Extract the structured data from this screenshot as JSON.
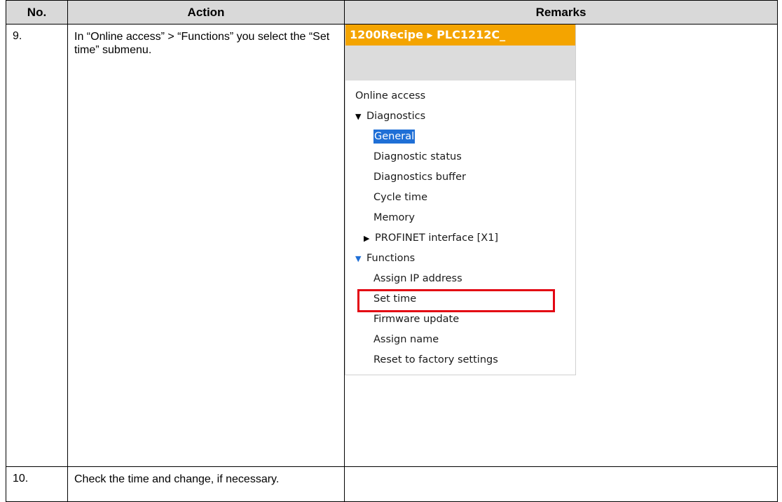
{
  "table": {
    "headers": {
      "no": "No.",
      "action": "Action",
      "remarks": "Remarks"
    },
    "rows": [
      {
        "no": "9.",
        "action": "In “Online access” > “Functions” you select the “Set time” submenu."
      },
      {
        "no": "10.",
        "action": "Check the time and change, if necessary."
      }
    ]
  },
  "panel": {
    "breadcrumb": "1200Recipe  ▸  PLC1212C_",
    "tree": {
      "online_access": "Online access",
      "diagnostics": "Diagnostics",
      "general": "General",
      "diagnostic_status": "Diagnostic status",
      "diagnostics_buffer": "Diagnostics buffer",
      "cycle_time": "Cycle time",
      "memory": "Memory",
      "profinet": "PROFINET interface [X1]",
      "functions": "Functions",
      "assign_ip": "Assign IP address",
      "set_time": "Set time",
      "firmware_update": "Firmware update",
      "assign_name": "Assign name",
      "reset_factory": "Reset to factory settings"
    },
    "colors": {
      "title_bar": "#f4a400",
      "selection": "#1f6fd6",
      "highlight_box": "#e30613"
    }
  }
}
